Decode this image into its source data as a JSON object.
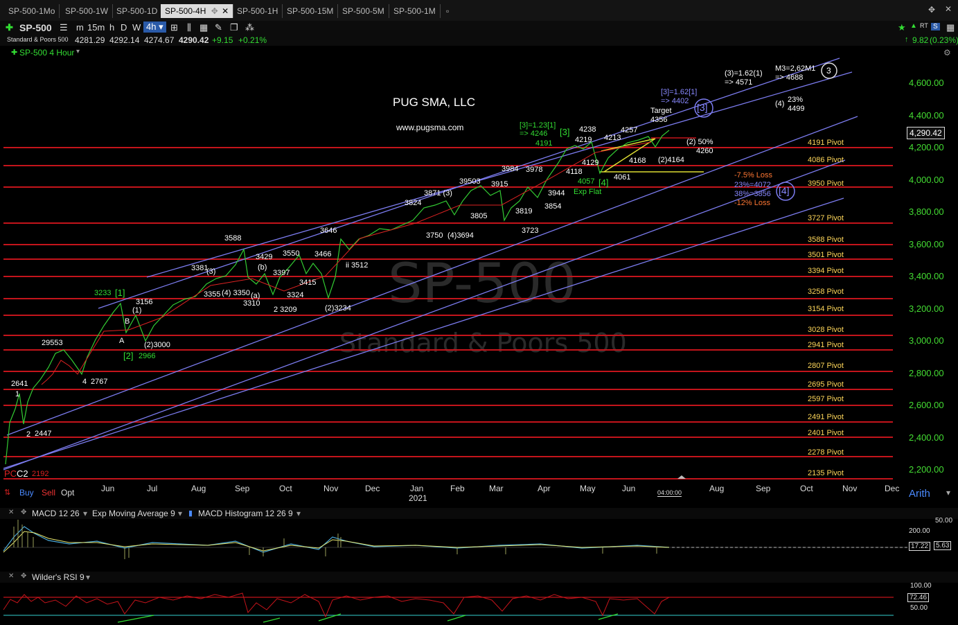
{
  "tabs": [
    "SP-500-1Mo",
    "SP-500-1W",
    "SP-500-1D",
    "SP-500-4H",
    "SP-500-1H",
    "SP-500-15M",
    "SP-500-5M",
    "SP-500-1M"
  ],
  "active_tab": "SP-500-4H",
  "toolbar": {
    "symbol": "SP-500",
    "intervals": [
      "m",
      "15m",
      "h",
      "D",
      "W",
      "4h"
    ],
    "right_badge": "RT",
    "right_badge2": "S"
  },
  "quote": {
    "name": "Standard & Poors 500",
    "open": "4281.29",
    "high": "4292.14",
    "low": "4274.67",
    "last": "4290.42",
    "change": "+9.15",
    "change_pct": "+0.21%",
    "right_change": "9.82",
    "right_change_pct": "(0.23%)"
  },
  "study_label": "SP-500 4 Hour",
  "watermark": {
    "title": "SP-500",
    "subtitle": "Standard & Poors 500"
  },
  "brand": {
    "name": "PUG SMA, LLC",
    "url": "www.pugsma.com"
  },
  "price_ticks": [
    "4,600.00",
    "4,400.00",
    "4,200.00",
    "4,000.00",
    "3,800.00",
    "3,600.00",
    "3,400.00",
    "3,200.00",
    "3,000.00",
    "2,800.00",
    "2,600.00",
    "2,400.00",
    "2,200.00"
  ],
  "last_price_box": "4,290.42",
  "pivots": [
    "4191 Pivot",
    "4086 Pivot",
    "3950 Pivot",
    "3727 Pivot",
    "3588 Pivot",
    "3501 Pivot",
    "3394 Pivot",
    "3258 Pivot",
    "3154 Pivot",
    "3028 Pivot",
    "2941 Pivot",
    "2807 Pivot",
    "2695 Pivot",
    "2597 Pivot",
    "2491 Pivot",
    "2401 Pivot",
    "2278 Pivot",
    "2135 Pivot"
  ],
  "months": [
    "Jun",
    "Jul",
    "Aug",
    "Sep",
    "Oct",
    "Nov",
    "Dec",
    "Jan",
    "Feb",
    "Mar",
    "Apr",
    "May",
    "Jun",
    "Aug",
    "Sep",
    "Oct",
    "Nov",
    "Dec"
  ],
  "year_label": "2021",
  "time_cursor": "04:00:00",
  "bottom_controls": {
    "buy": "Buy",
    "sell": "Sell",
    "opt": "Opt",
    "scale": "Arith"
  },
  "annotations": {
    "pc": "PC",
    "c2": "C2",
    "v2192": "2192",
    "a1": "1",
    "v2641": "2641",
    "a2": "2",
    "v2447": "2447",
    "v2955": "29553",
    "a4": "4",
    "v2767": "2767",
    "v3233": "3233",
    "w1": "[1]",
    "w2": "[2]",
    "v2966": "2966",
    "aA": "A",
    "aB": "B",
    "v3156": "3156",
    "p1": "(1)",
    "p2_3000": "(2)3000",
    "v3355": "3355",
    "v3381": "3381",
    "p3": "(3)",
    "v3588": "3588",
    "v3429": "3429",
    "pb": "(b)",
    "p4_3350": "(4) 3350",
    "pa": "(a)",
    "v3310": "3310",
    "v3397": "3397",
    "v3550": "3550",
    "v3466": "3466",
    "v3324": "3324",
    "v3415": "3415",
    "v2_3209": "2  3209",
    "v3646": "3646",
    "v3512": "ii 3512",
    "p2_3234": "(2)3234",
    "v3824": "3824",
    "v3871": "3871 (3)",
    "v3950": "39503",
    "v3750": "3750",
    "p4_3694": "(4)3694",
    "v3805": "3805",
    "v3984": "3984",
    "v3915": "3915",
    "v3978": "3978",
    "v3819": "3819",
    "v3854": "3854",
    "v3944": "3944",
    "v3723": "3723",
    "w3_123": "[3]=1.23[1]",
    "w3_4246": "=> 4246",
    "v4191": "4191",
    "w3": "[3]",
    "v4238": "4238",
    "v4219": "4219",
    "v4213": "4213",
    "v4257": "4257",
    "v4129": "4129",
    "v4118": "4118",
    "v4168": "4168",
    "v4164": "(2)4164",
    "v4061": "4061",
    "v4057": "4057",
    "w4_small": "[4]",
    "exp_flat": "Exp Flat",
    "target": "Target",
    "v4356": "4356",
    "w3_162": "[3]=1.62[1]",
    "w3_4402": "=> 4402",
    "p3_162": "(3)=1.62(1)",
    "p3_4571": "=> 4571",
    "m3": "M3=2,62M1",
    "m3_4688": "=> 4688",
    "p4": "(4)",
    "v23pct": "23%",
    "v4499": "4499",
    "p2_50": "(2) 50%",
    "v4260": "4260",
    "loss75": "-7.5% Loss",
    "l23": "23%=4072",
    "l38": "38%=3856",
    "loss12": "-12% Loss",
    "w4": "[4]",
    "w3c": "[3]",
    "c3": "3"
  },
  "macd_panel": {
    "title1": "MACD 12 26",
    "title2": "Exp Moving Average 9",
    "title3": "MACD Histogram 12 26 9",
    "ticks": [
      "50.00",
      "200.00",
      "17.22",
      "5.63"
    ]
  },
  "rsi_panel": {
    "title": "Wilder's RSI 9",
    "ticks": [
      "100.00",
      "72.46",
      "50.00"
    ]
  },
  "colors": {
    "pivot": "#c4141b",
    "channel": "#7c7cf0",
    "green": "#33dd33",
    "price": "#44dd33"
  }
}
